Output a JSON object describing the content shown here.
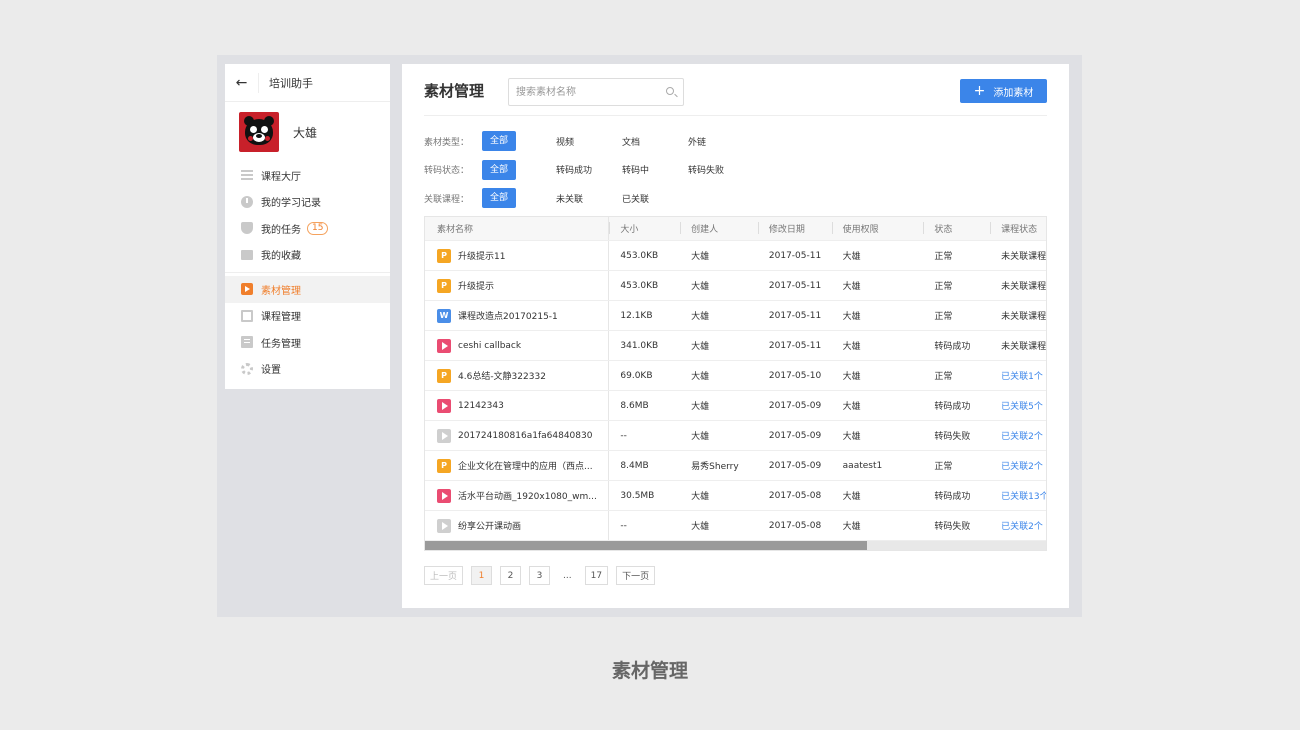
{
  "sidebar": {
    "title": "培训助手",
    "back_icon": "arrow-left-icon",
    "user_name": "大雄",
    "items": [
      {
        "label": "课程大厅",
        "icon": "list-icon"
      },
      {
        "label": "我的学习记录",
        "icon": "clock-icon"
      },
      {
        "label": "我的任务",
        "icon": "shield-icon",
        "badge": "15"
      },
      {
        "label": "我的收藏",
        "icon": "folder-icon"
      },
      {
        "label": "素材管理",
        "icon": "media-icon",
        "active": true
      },
      {
        "label": "课程管理",
        "icon": "course-icon"
      },
      {
        "label": "任务管理",
        "icon": "task-icon"
      },
      {
        "label": "设置",
        "icon": "gear-icon"
      }
    ]
  },
  "main": {
    "title": "素材管理",
    "search_placeholder": "搜索素材名称",
    "add_button": "添加素材",
    "filters": [
      {
        "label": "素材类型：",
        "options": [
          "全部",
          "视频",
          "文档",
          "外链"
        ]
      },
      {
        "label": "转码状态：",
        "options": [
          "全部",
          "转码成功",
          "转码中",
          "转码失败"
        ]
      },
      {
        "label": "关联课程：",
        "options": [
          "全部",
          "未关联",
          "已关联"
        ]
      }
    ],
    "table": {
      "headers": [
        "素材名称",
        "大小",
        "创建人",
        "修改日期",
        "使用权限",
        "状态",
        "课程状态"
      ],
      "rows": [
        {
          "type": "P",
          "name": "升级提示11",
          "size": "453.0KB",
          "creator": "大雄",
          "date": "2017-05-11",
          "perm": "大雄",
          "status": "正常",
          "course": "未关联课程"
        },
        {
          "type": "P",
          "name": "升级提示",
          "size": "453.0KB",
          "creator": "大雄",
          "date": "2017-05-11",
          "perm": "大雄",
          "status": "正常",
          "course": "未关联课程"
        },
        {
          "type": "W",
          "name": "课程改造点20170215-1",
          "size": "12.1KB",
          "creator": "大雄",
          "date": "2017-05-11",
          "perm": "大雄",
          "status": "正常",
          "course": "未关联课程"
        },
        {
          "type": "V",
          "name": "ceshi callback",
          "size": "341.0KB",
          "creator": "大雄",
          "date": "2017-05-11",
          "perm": "大雄",
          "status": "转码成功",
          "course": "未关联课程"
        },
        {
          "type": "P",
          "name": "4.6总结-文静322332",
          "size": "69.0KB",
          "creator": "大雄",
          "date": "2017-05-10",
          "perm": "大雄",
          "status": "正常",
          "course": "已关联1个",
          "linked": true
        },
        {
          "type": "V",
          "name": "12142343",
          "size": "8.6MB",
          "creator": "大雄",
          "date": "2017-05-09",
          "perm": "大雄",
          "status": "转码成功",
          "course": "已关联5个",
          "linked": true
        },
        {
          "type": "G",
          "name": "201724180816a1fa64840830",
          "size": "--",
          "creator": "大雄",
          "date": "2017-05-09",
          "perm": "大雄",
          "status": "转码失败",
          "course": "已关联2个",
          "linked": true
        },
        {
          "type": "P",
          "name": "企业文化在管理中的应用（西点...",
          "size": "8.4MB",
          "creator": "易秀Sherry",
          "date": "2017-05-09",
          "perm": "aaatest1",
          "status": "正常",
          "course": "已关联2个",
          "linked": true
        },
        {
          "type": "V",
          "name": "活水平台动画_1920x1080_wm...",
          "size": "30.5MB",
          "creator": "大雄",
          "date": "2017-05-08",
          "perm": "大雄",
          "status": "转码成功",
          "course": "已关联13个",
          "linked": true
        },
        {
          "type": "G",
          "name": "纷享公开课动画",
          "size": "--",
          "creator": "大雄",
          "date": "2017-05-08",
          "perm": "大雄",
          "status": "转码失败",
          "course": "已关联2个",
          "linked": true
        }
      ]
    },
    "pager": {
      "prev": "上一页",
      "pages": [
        "1",
        "2",
        "3"
      ],
      "dots": "...",
      "last": "17",
      "next": "下一页",
      "current": "1"
    }
  },
  "caption": "素材管理",
  "colors": {
    "accent": "#3b85e9",
    "active": "#f07f2c"
  }
}
